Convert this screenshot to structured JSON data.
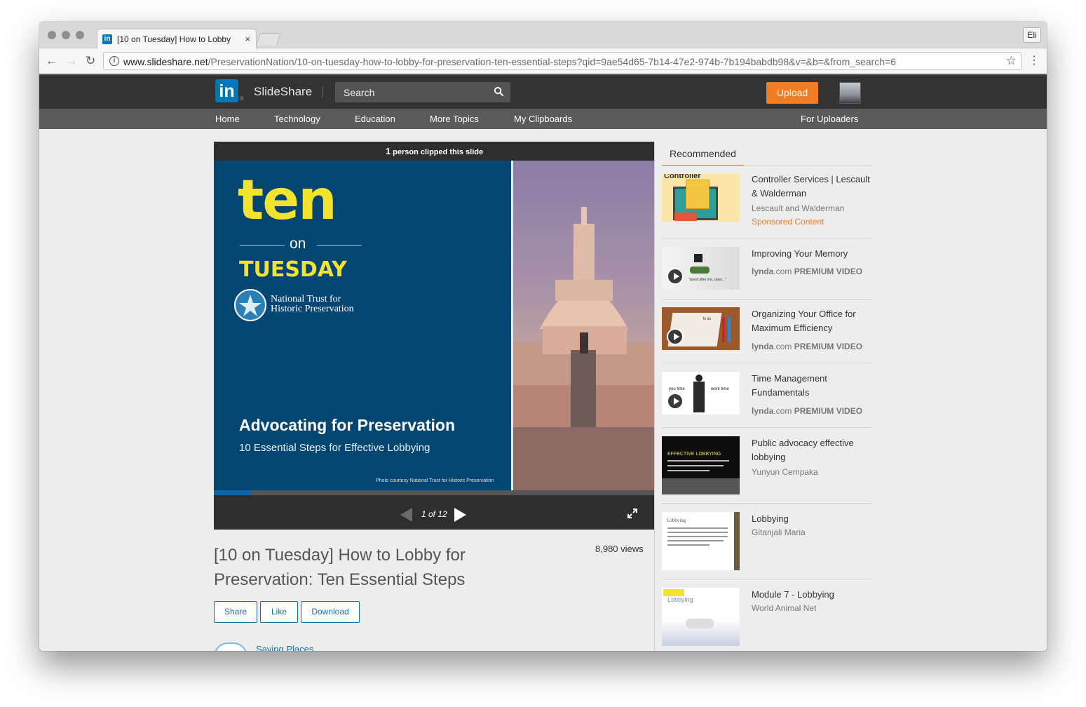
{
  "browser": {
    "tab_title": "[10 on Tuesday] How to Lobby",
    "tab_favicon": "in",
    "tab_close": "×",
    "profile": "Eli",
    "url_domain": "www.slideshare.net",
    "url_path": "/PreservationNation/10-on-tuesday-how-to-lobby-for-preservation-ten-essential-steps?qid=9ae54d65-7b14-47e2-974b-7b194babdb98&v=&b=&from_search=6",
    "icons": [
      "back-arrow-icon",
      "forward-arrow-icon",
      "reload-icon",
      "info-icon",
      "star-icon",
      "menu-icon"
    ]
  },
  "site_header": {
    "logo_text": "in",
    "brand": "SlideShare",
    "search_placeholder": "Search",
    "upload_label": "Upload"
  },
  "nav": {
    "items": [
      "Home",
      "Technology",
      "Education",
      "More Topics",
      "My Clipboards"
    ],
    "right_item": "For Uploaders"
  },
  "player": {
    "clip_count": "1",
    "clip_text": "person clipped this slide",
    "current_page": 1,
    "total_pages": 12,
    "page_counter": "1 of 12",
    "progress_fraction": 0.083,
    "slide": {
      "ten": "ten",
      "on": "on",
      "tuesday": "TUESDAY",
      "org_line1": "National Trust for",
      "org_line2": "Historic Preservation",
      "heading": "Advocating for Preservation",
      "subheading": "10 Essential Steps for Effective Lobbying",
      "credit": "Photo courtesy National Trust for Historic Preservation",
      "colors": {
        "background": "#044673",
        "accent_yellow": "#f1e32e"
      }
    }
  },
  "presentation": {
    "title": "[10 on Tuesday] How to Lobby for Preservation: Ten Essential Steps",
    "views": "8,980 views",
    "buttons": {
      "share": "Share",
      "like": "Like",
      "download": "Download"
    },
    "author": "Saving Places"
  },
  "sidebar": {
    "tab_label": "Recommended",
    "items": [
      {
        "title": "Controller Services | Lescault & Walderman",
        "author": "Lescault and Walderman",
        "sponsored": "Sponsored Content",
        "thumb_text": "Controller"
      },
      {
        "title": "Improving Your Memory",
        "source": "lynda",
        "source_suffix": ".com",
        "badge": "PREMIUM VIDEO",
        "thumb_text": "\"speat after me, class...\""
      },
      {
        "title": "Organizing Your Office for Maximum Efficiency",
        "source": "lynda",
        "source_suffix": ".com",
        "badge": "PREMIUM VIDEO",
        "thumb_text": "To do"
      },
      {
        "title": "Time Management Fundamentals",
        "source": "lynda",
        "source_suffix": ".com",
        "badge": "PREMIUM VIDEO",
        "thumb_left": "you time",
        "thumb_right": "work time"
      },
      {
        "title": "Public advocacy effective lobbying",
        "author": "Yunyun Cempaka",
        "thumb_text": "EFFECTIVE LOBBYING"
      },
      {
        "title": "Lobbying",
        "author": "Gitanjali Maria",
        "thumb_text": "Lobbying"
      },
      {
        "title": "Module 7 - Lobbying",
        "author": "World Animal Net",
        "thumb_text": "Lobbying"
      }
    ],
    "accent_color": "#f17d22"
  }
}
